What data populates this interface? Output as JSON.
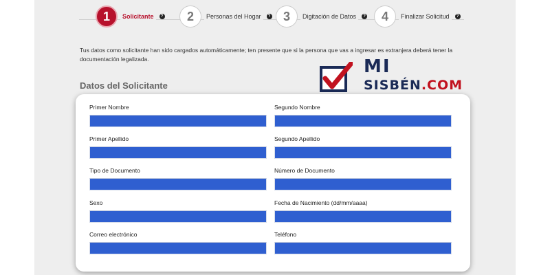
{
  "stepper": {
    "steps": [
      {
        "number": "1",
        "label": "Solicitante",
        "help_icon": "?"
      },
      {
        "number": "2",
        "label": "Personas del Hogar",
        "help_icon": "?"
      },
      {
        "number": "3",
        "label": "Digitación de Datos",
        "help_icon": "?"
      },
      {
        "number": "4",
        "label": "Finalizar Solicitud",
        "help_icon": "?"
      }
    ],
    "active_color": "#b7112c"
  },
  "intro": {
    "text": "Tus datos como solicitante han sido cargados automáticamente; ten presente que si la persona que vas a ingresar es extranjera deberá tener la documentación legalizada."
  },
  "section": {
    "title": "Datos del Solicitante"
  },
  "logo": {
    "mi": "MI",
    "sisben": "SISBÉN",
    "com": ".COM"
  },
  "form": {
    "fields": [
      {
        "label": "Primer Nombre",
        "value": ""
      },
      {
        "label": "Segundo Nombre",
        "value": ""
      },
      {
        "label": "Primer Apellido",
        "value": ""
      },
      {
        "label": "Segundo Apellido",
        "value": ""
      },
      {
        "label": "Tipo de Documento",
        "value": ""
      },
      {
        "label": "Número de Documento",
        "value": ""
      },
      {
        "label": "Sexo",
        "value": ""
      },
      {
        "label": "Fecha de Nacimiento (dd/mm/aaaa)",
        "value": ""
      },
      {
        "label": "Correo electrónico",
        "value": ""
      },
      {
        "label": "Teléfono",
        "value": ""
      }
    ],
    "input_fill_color": "#2f5fd0"
  }
}
